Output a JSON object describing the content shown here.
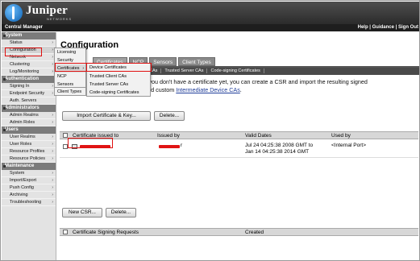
{
  "header": {
    "brand": "Juniper",
    "brand_sub": "NETWORKS",
    "app_name": "Central Manager",
    "links": "Help | Guidance | Sign Out"
  },
  "sidebar": {
    "sections": [
      {
        "label": "System",
        "items": [
          "Status",
          "Configuration",
          "Network",
          "Clustering",
          "Log/Monitoring"
        ]
      },
      {
        "label": "Authentication",
        "items": [
          "Signing In",
          "Endpoint Security",
          "Auth. Servers"
        ]
      },
      {
        "label": "Administrators",
        "items": [
          "Admin Realms",
          "Admin Roles"
        ]
      },
      {
        "label": "Users",
        "items": [
          "User Realms",
          "User Roles",
          "Resource Profiles",
          "Resource Policies"
        ]
      },
      {
        "label": "Maintenance",
        "items": [
          "System",
          "Import/Export",
          "Push Config",
          "Archiving",
          "Troubleshooting"
        ]
      }
    ]
  },
  "flyout1": {
    "items": [
      "Licensing",
      "Security",
      "Certificates",
      "NCP",
      "Sensors",
      "Client Types"
    ]
  },
  "flyout2": {
    "items": [
      "Device Certificates",
      "Trusted Client CAs",
      "Trusted Server CAs",
      "Code-signing Certificates"
    ]
  },
  "page": {
    "title": "Configuration",
    "tabs": [
      "Certificates",
      "NCP",
      "Sensors",
      "Client Types"
    ],
    "subtabs": [
      "CAs",
      "Trusted Server CAs",
      "Code-signing Certificates"
    ],
    "desc_line1": "Specify the device certificate(s). If you don't have a certificate yet, you can create a CSR and import the resulting signed",
    "desc_line2": "certificate. If necessary, you can add custom",
    "desc_link": "Intermediate Device CAs",
    "desc_end": "."
  },
  "buttons": {
    "import": "Import Certificate & Key...",
    "delete": "Delete...",
    "new_csr": "New CSR...",
    "delete2": "Delete..."
  },
  "cert_table": {
    "headers": [
      "Certificate issued to",
      "Issued by",
      "Valid Dates",
      "Used by"
    ],
    "rows": [
      {
        "valid_line1": "Jul 24 04:25:38 2008 GMT to",
        "valid_line2": "Jan 14 04:25:38 2014 GMT",
        "issued_by_suffix": "r",
        "used_by": "<Internal Port>"
      }
    ]
  },
  "csr_table": {
    "headers": [
      "Certificate Signing Requests",
      "Created"
    ]
  },
  "colors": {
    "highlight": "#e01010"
  }
}
